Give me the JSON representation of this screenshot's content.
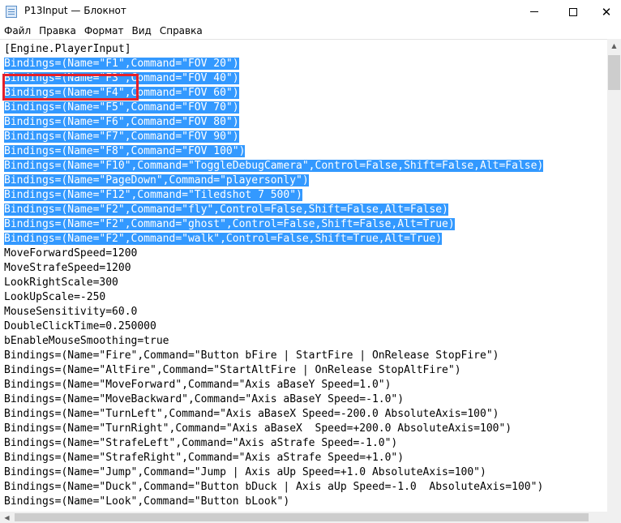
{
  "window": {
    "title": "P13Input — Блокнот",
    "icon": "notepad-icon",
    "minimize_icon": "minimize-icon",
    "maximize_icon": "maximize-icon",
    "close_label": "✕"
  },
  "menu": [
    "Файл",
    "Правка",
    "Формат",
    "Вид",
    "Справка"
  ],
  "editor": {
    "lines": [
      {
        "text": "[Engine.PlayerInput]",
        "selected": false
      },
      {
        "text": "Bindings=(Name=\"F1\",Command=\"FOV 20\")",
        "selected": true
      },
      {
        "text": "Bindings=(Name=\"F3\",Command=\"FOV 40\")",
        "selected": true
      },
      {
        "text": "Bindings=(Name=\"F4\",Command=\"FOV 60\")",
        "selected": true
      },
      {
        "text": "Bindings=(Name=\"F5\",Command=\"FOV 70\")",
        "selected": true
      },
      {
        "text": "Bindings=(Name=\"F6\",Command=\"FOV 80\")",
        "selected": true
      },
      {
        "text": "Bindings=(Name=\"F7\",Command=\"FOV 90\")",
        "selected": true
      },
      {
        "text": "Bindings=(Name=\"F8\",Command=\"FOV 100\")",
        "selected": true
      },
      {
        "text": "Bindings=(Name=\"F10\",Command=\"ToggleDebugCamera\",Control=False,Shift=False,Alt=False)",
        "selected": true
      },
      {
        "text": "Bindings=(Name=\"PageDown\",Command=\"playersonly\")",
        "selected": true
      },
      {
        "text": "Bindings=(Name=\"F12\",Command=\"Tiledshot 7 500\")",
        "selected": true
      },
      {
        "text": "Bindings=(Name=\"F2\",Command=\"fly\",Control=False,Shift=False,Alt=False)",
        "selected": true
      },
      {
        "text": "Bindings=(Name=\"F2\",Command=\"ghost\",Control=False,Shift=False,Alt=True)",
        "selected": true
      },
      {
        "text": "Bindings=(Name=\"F2\",Command=\"walk\",Control=False,Shift=True,Alt=True)",
        "selected": true
      },
      {
        "text": "MoveForwardSpeed=1200",
        "selected": false
      },
      {
        "text": "MoveStrafeSpeed=1200",
        "selected": false
      },
      {
        "text": "LookRightScale=300",
        "selected": false
      },
      {
        "text": "LookUpScale=-250",
        "selected": false
      },
      {
        "text": "MouseSensitivity=60.0",
        "selected": false
      },
      {
        "text": "DoubleClickTime=0.250000",
        "selected": false
      },
      {
        "text": "bEnableMouseSmoothing=true",
        "selected": false
      },
      {
        "text": "Bindings=(Name=\"Fire\",Command=\"Button bFire | StartFire | OnRelease StopFire\")",
        "selected": false
      },
      {
        "text": "Bindings=(Name=\"AltFire\",Command=\"StartAltFire | OnRelease StopAltFire\")",
        "selected": false
      },
      {
        "text": "Bindings=(Name=\"MoveForward\",Command=\"Axis aBaseY Speed=1.0\")",
        "selected": false
      },
      {
        "text": "Bindings=(Name=\"MoveBackward\",Command=\"Axis aBaseY Speed=-1.0\")",
        "selected": false
      },
      {
        "text": "Bindings=(Name=\"TurnLeft\",Command=\"Axis aBaseX Speed=-200.0 AbsoluteAxis=100\")",
        "selected": false
      },
      {
        "text": "Bindings=(Name=\"TurnRight\",Command=\"Axis aBaseX  Speed=+200.0 AbsoluteAxis=100\")",
        "selected": false
      },
      {
        "text": "Bindings=(Name=\"StrafeLeft\",Command=\"Axis aStrafe Speed=-1.0\")",
        "selected": false
      },
      {
        "text": "Bindings=(Name=\"StrafeRight\",Command=\"Axis aStrafe Speed=+1.0\")",
        "selected": false
      },
      {
        "text": "Bindings=(Name=\"Jump\",Command=\"Jump | Axis aUp Speed=+1.0 AbsoluteAxis=100\")",
        "selected": false
      },
      {
        "text": "Bindings=(Name=\"Duck\",Command=\"Button bDuck | Axis aUp Speed=-1.0  AbsoluteAxis=100\")",
        "selected": false
      },
      {
        "text": "Bindings=(Name=\"Look\",Command=\"Button bLook\")",
        "selected": false
      }
    ]
  },
  "annotation": {
    "color": "#e5202a"
  },
  "colors": {
    "selection": "#3399ff",
    "selection_text": "#ffffff"
  }
}
